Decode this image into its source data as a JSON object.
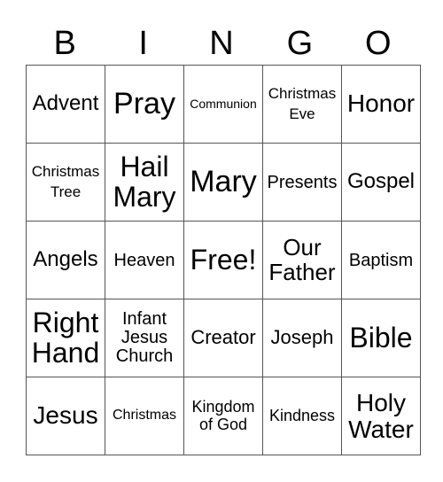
{
  "header": [
    "B",
    "I",
    "N",
    "G",
    "O"
  ],
  "grid": [
    [
      "Advent",
      "Pray",
      "Communion",
      "Christmas\nEve",
      "Honor"
    ],
    [
      "Christmas\nTree",
      "Hail\nMary",
      "Mary",
      "Presents",
      "Gospel"
    ],
    [
      "Angels",
      "Heaven",
      "Free!",
      "Our\nFather",
      "Baptism"
    ],
    [
      "Right\nHand",
      "Infant\nJesus\nChurch",
      "Creator",
      "Joseph",
      "Bible"
    ],
    [
      "Jesus",
      "Christmas",
      "Kingdom\nof God",
      "Kindness",
      "Holy\nWater"
    ]
  ],
  "free_space": "Free!"
}
